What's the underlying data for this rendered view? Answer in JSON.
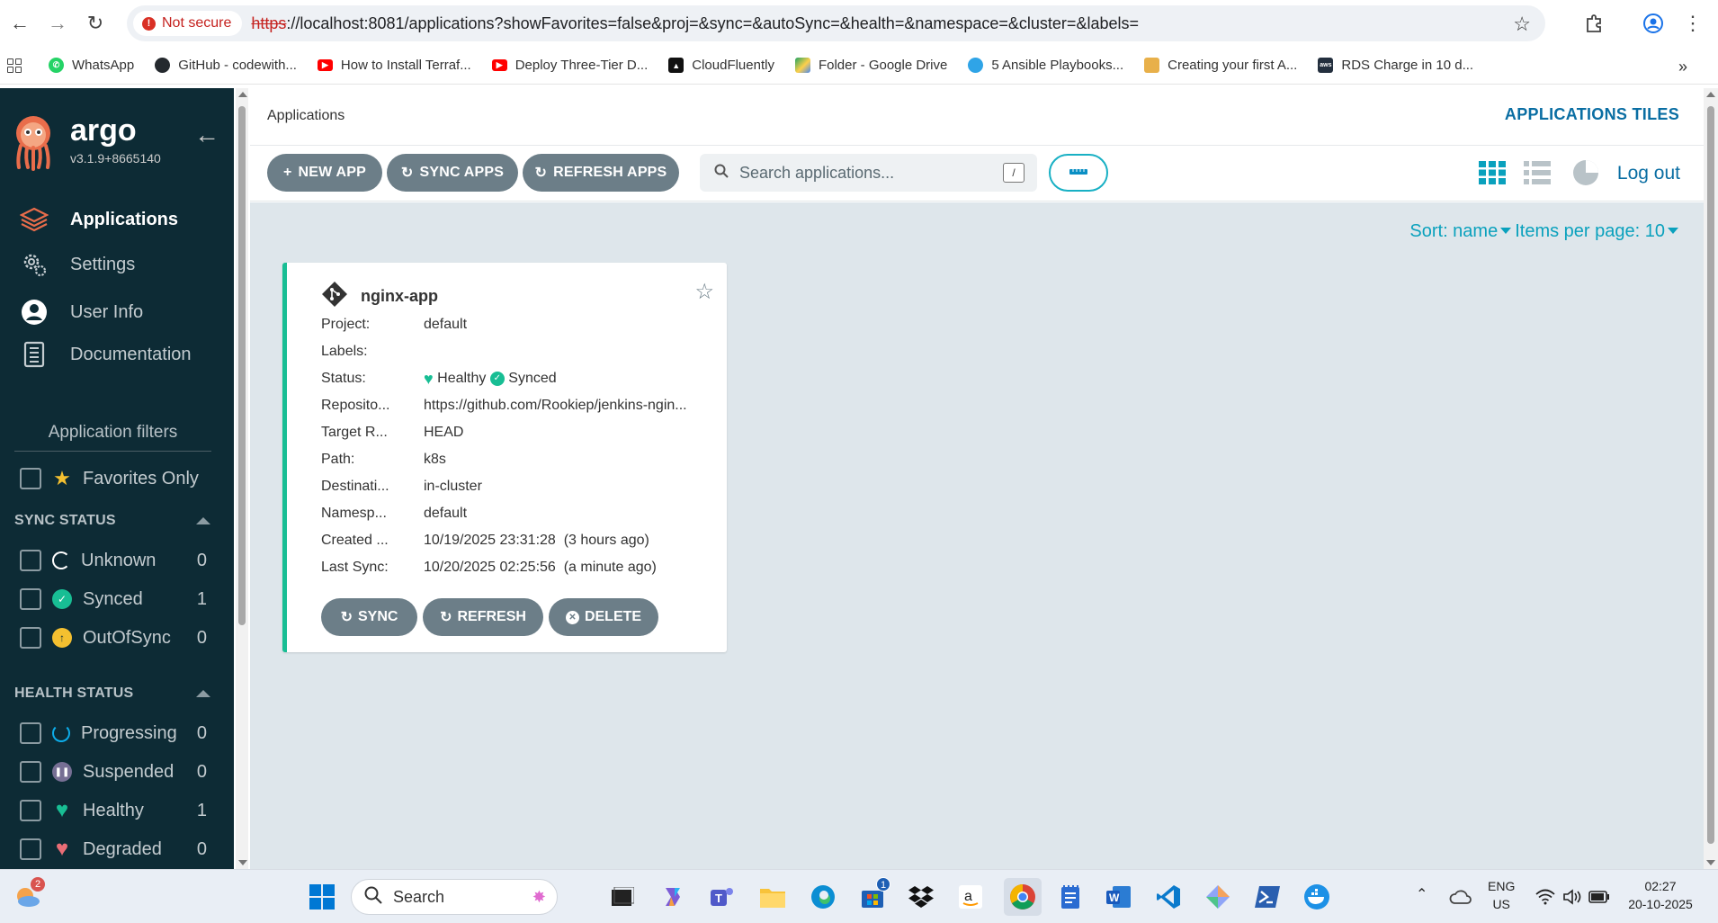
{
  "browser": {
    "security_label": "Not secure",
    "url_scheme": "https",
    "url_rest": "://localhost:8081/applications?showFavorites=false&proj=&sync=&autoSync=&health=&namespace=&cluster=&labels=",
    "bookmarks": [
      {
        "label": "WhatsApp",
        "color": "#25d366"
      },
      {
        "label": "GitHub - codewith...",
        "color": "#24292e"
      },
      {
        "label": "How to Install Terraf...",
        "color": "#ff0000"
      },
      {
        "label": "Deploy Three-Tier D...",
        "color": "#ff0000"
      },
      {
        "label": "CloudFluently",
        "color": "#111111"
      },
      {
        "label": "Folder - Google Drive",
        "color": "#1fa463"
      },
      {
        "label": "5 Ansible Playbooks...",
        "color": "#2fa4e7"
      },
      {
        "label": "Creating your first A...",
        "color": "#e8b04a"
      },
      {
        "label": "RDS Charge in 10 d...",
        "color": "#232f3e"
      }
    ]
  },
  "sidebar": {
    "brand": "argo",
    "version": "v3.1.9+8665140",
    "menu": [
      {
        "label": "Applications",
        "icon": "layers-icon"
      },
      {
        "label": "Settings",
        "icon": "gears-icon"
      },
      {
        "label": "User Info",
        "icon": "user-icon"
      },
      {
        "label": "Documentation",
        "icon": "book-icon"
      }
    ],
    "filters_title": "Application filters",
    "favorites_label": "Favorites Only",
    "sync_status_title": "SYNC STATUS",
    "sync_status": [
      {
        "label": "Unknown",
        "count": "0"
      },
      {
        "label": "Synced",
        "count": "1"
      },
      {
        "label": "OutOfSync",
        "count": "0"
      }
    ],
    "health_status_title": "HEALTH STATUS",
    "health_status": [
      {
        "label": "Progressing",
        "count": "0"
      },
      {
        "label": "Suspended",
        "count": "0"
      },
      {
        "label": "Healthy",
        "count": "1"
      },
      {
        "label": "Degraded",
        "count": "0"
      }
    ]
  },
  "topbar": {
    "breadcrumb": "Applications",
    "view_title": "APPLICATIONS TILES"
  },
  "toolbar": {
    "new_app": "NEW APP",
    "sync_apps": "SYNC APPS",
    "refresh_apps": "REFRESH APPS",
    "search_placeholder": "Search applications...",
    "search_shortcut": "/",
    "logout": "Log out"
  },
  "content": {
    "sort_label": "Sort: name",
    "items_per_page_label": "Items per page: 10"
  },
  "app_card": {
    "name": "nginx-app",
    "rows": [
      {
        "key": "Project:",
        "value": "default"
      },
      {
        "key": "Labels:",
        "value": ""
      },
      {
        "key": "Status:",
        "value": ""
      },
      {
        "key": "Reposito...",
        "value": "https://github.com/Rookiep/jenkins-ngin..."
      },
      {
        "key": "Target R...",
        "value": "HEAD"
      },
      {
        "key": "Path:",
        "value": "k8s"
      },
      {
        "key": "Destinati...",
        "value": "in-cluster"
      },
      {
        "key": "Namesp...",
        "value": "default"
      },
      {
        "key": "Created ...",
        "value": "10/19/2025 23:31:28  (3 hours ago)"
      },
      {
        "key": "Last Sync:",
        "value": "10/20/2025 02:25:56  (a minute ago)"
      }
    ],
    "health": "Healthy",
    "sync": "Synced",
    "sync_btn": "SYNC",
    "refresh_btn": "REFRESH",
    "delete_btn": "DELETE"
  },
  "taskbar": {
    "search_label": "Search",
    "lang_line1": "ENG",
    "lang_line2": "US",
    "time": "02:27",
    "date": "20-10-2025",
    "weather_badge": "2",
    "store_badge": "1"
  },
  "colors": {
    "sidebar_bg": "#0d2b35",
    "accent_teal": "#0aa1bd",
    "healthy_green": "#18be94",
    "button_gray": "#6c7e88"
  }
}
